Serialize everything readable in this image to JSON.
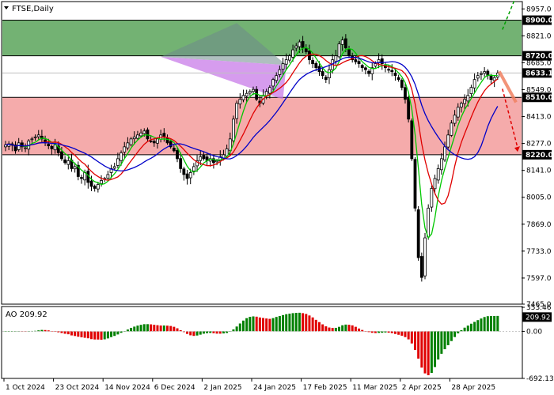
{
  "header": {
    "menu_icon": "triangle-down-icon",
    "title": "FTSE,Daily"
  },
  "indicator": {
    "label": "AO 209.92"
  },
  "colors": {
    "background": "#ffffff",
    "resistance_zone": "#5aa55a",
    "support_zone": "#f4a6a6",
    "triangle_fill": "#c87be8",
    "triangle_top": "#6e8a8a",
    "candle_up": "#000000",
    "candle_down": "#000000",
    "ma_fast": "#00c800",
    "ma_mid": "#e00000",
    "ma_slow": "#0000c8",
    "ao_up": "#008000",
    "ao_down": "#e00000",
    "arrow_up": "#00a000",
    "arrow_down": "#e00000",
    "arrow_flat": "#f08060"
  },
  "chart_data": [
    {
      "type": "candlestick",
      "title": "FTSE,Daily",
      "ylim": [
        7465.0,
        8990.0
      ],
      "y_ticks": [
        "8957.0",
        "8821.0",
        "8685.0",
        "8549.0",
        "8413.0",
        "8277.0",
        "8141.0",
        "8005.0",
        "7869.0",
        "7733.0",
        "7597.0",
        "7465.0"
      ],
      "x_ticks": [
        "1 Oct 2024",
        "23 Oct 2024",
        "14 Nov 2024",
        "6 Dec 2024",
        "2 Jan 2025",
        "24 Jan 2025",
        "17 Feb 2025",
        "11 Mar 2025",
        "2 Apr 2025",
        "28 Apr 2025"
      ],
      "price_labels": [
        {
          "value": 8900.0,
          "text": "8900.0",
          "style": "dark"
        },
        {
          "value": 8720.0,
          "text": "8720.0",
          "style": "dark"
        },
        {
          "value": 8633.1,
          "text": "8633.1",
          "style": "dark"
        },
        {
          "value": 8510.0,
          "text": "8510.0",
          "style": "dark"
        },
        {
          "value": 8220.0,
          "text": "8220.0",
          "style": "dark"
        }
      ],
      "zones": [
        {
          "name": "resistance",
          "from": 8720.0,
          "to": 8900.0
        },
        {
          "name": "support",
          "from": 8220.0,
          "to": 8510.0
        }
      ],
      "horizontal_lines": [
        8633.1
      ],
      "close": [
        8270,
        8275,
        8268,
        8240,
        8280,
        8260,
        8255,
        8290,
        8300,
        8310,
        8320,
        8300,
        8280,
        8265,
        8250,
        8270,
        8230,
        8200,
        8180,
        8190,
        8150,
        8160,
        8110,
        8100,
        8130,
        8080,
        8060,
        8050,
        8070,
        8090,
        8100,
        8120,
        8150,
        8160,
        8200,
        8230,
        8260,
        8280,
        8300,
        8310,
        8320,
        8330,
        8340,
        8300,
        8290,
        8280,
        8300,
        8320,
        8310,
        8280,
        8260,
        8240,
        8200,
        8150,
        8120,
        8100,
        8130,
        8160,
        8190,
        8210,
        8200,
        8190,
        8200,
        8180,
        8190,
        8210,
        8220,
        8250,
        8300,
        8400,
        8480,
        8500,
        8520,
        8530,
        8540,
        8550,
        8500,
        8480,
        8520,
        8540,
        8560,
        8600,
        8620,
        8650,
        8680,
        8700,
        8720,
        8750,
        8770,
        8790,
        8760,
        8740,
        8700,
        8680,
        8660,
        8640,
        8620,
        8600,
        8650,
        8700,
        8720,
        8780,
        8800,
        8760,
        8720,
        8700,
        8690,
        8680,
        8660,
        8650,
        8630,
        8660,
        8680,
        8700,
        8680,
        8660,
        8650,
        8640,
        8620,
        8600,
        8560,
        8500,
        8400,
        8200,
        7950,
        7700,
        7600,
        7800,
        7950,
        8050,
        8100,
        8150,
        8200,
        8260,
        8320,
        8380,
        8420,
        8460,
        8480,
        8500,
        8520,
        8560,
        8600,
        8620,
        8630,
        8640,
        8620,
        8600,
        8610,
        8633
      ]
    },
    {
      "type": "bar",
      "title": "AO 209.92",
      "ylim": [
        -692.13,
        353.46
      ],
      "y_ticks": [
        "353.46",
        "0.00",
        "-692.13"
      ],
      "last_value": 209.92
    }
  ]
}
